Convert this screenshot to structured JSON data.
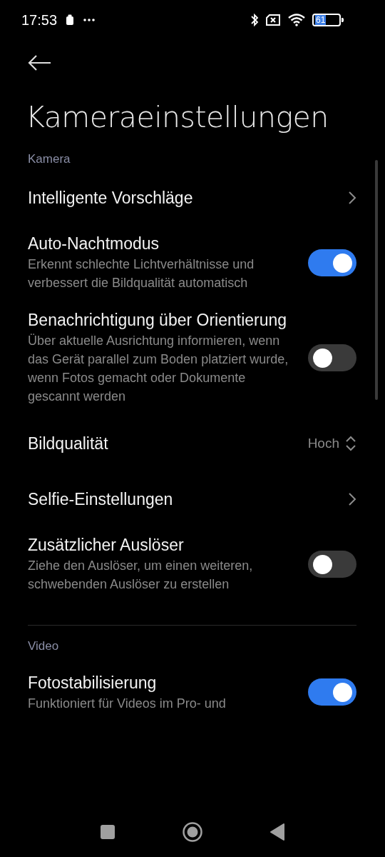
{
  "status_bar": {
    "time": "17:53",
    "battery": "61"
  },
  "title": "Kameraeinstellungen",
  "sections": [
    {
      "header": "Kamera",
      "items": [
        {
          "kind": "link",
          "title": "Intelligente Vorschläge"
        },
        {
          "kind": "toggle",
          "title": "Auto-Nachtmodus",
          "description": "Erkennt schlechte Lichtverhältnisse und verbessert die Bildqualität automatisch",
          "on": true
        },
        {
          "kind": "toggle",
          "title": "Benachrichtigung über Orientierung",
          "description": "Über aktuelle Ausrichtung informieren, wenn das Gerät parallel zum Boden platziert wurde, wenn Fotos gemacht oder Dokumente gescannt werden",
          "on": false
        },
        {
          "kind": "value",
          "title": "Bildqualität",
          "value": "Hoch"
        },
        {
          "kind": "link",
          "title": "Selfie-Einstellungen"
        },
        {
          "kind": "toggle",
          "title": "Zusätzlicher Auslöser",
          "description": "Ziehe den Auslöser, um einen weiteren, schwebenden Auslöser zu erstellen",
          "on": false
        }
      ]
    },
    {
      "header": "Video",
      "items": [
        {
          "kind": "toggle",
          "title": "Fotostabilisierung",
          "description": "Funktioniert für Videos im Pro- und",
          "on": true
        }
      ]
    }
  ]
}
